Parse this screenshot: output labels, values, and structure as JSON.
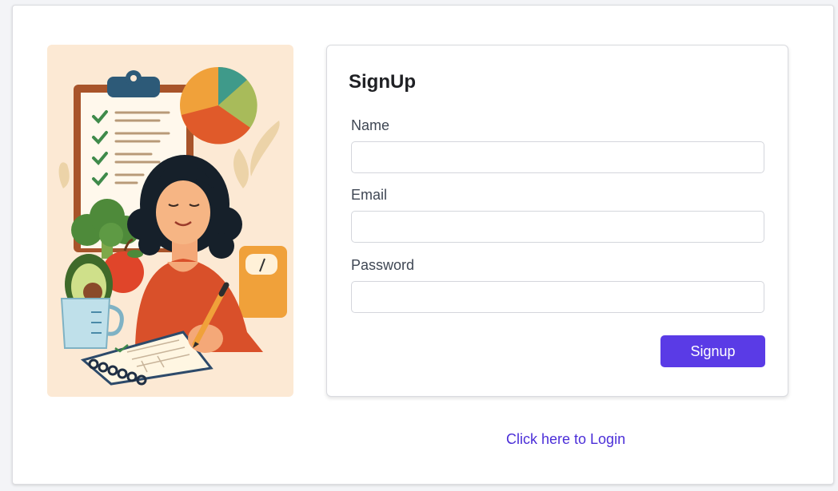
{
  "form": {
    "title": "SignUp",
    "fields": [
      {
        "label": "Name",
        "value": "",
        "placeholder": ""
      },
      {
        "label": "Email",
        "value": "",
        "placeholder": ""
      },
      {
        "label": "Password",
        "value": "",
        "placeholder": ""
      }
    ],
    "submit_label": "Signup"
  },
  "login_link": {
    "text": "Click here to Login"
  },
  "colors": {
    "accent": "#5a3be6",
    "link": "#4b2ed8",
    "illustration_bg": "#fce9d4"
  }
}
